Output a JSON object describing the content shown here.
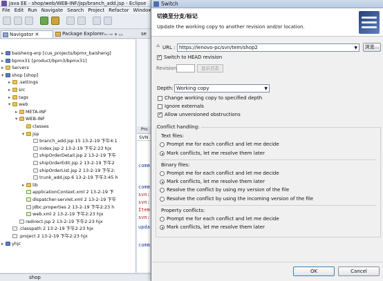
{
  "eclipse": {
    "window_title": "Java EE - shop/web/WEB-INF/jsp/branch_add.jsp - Eclipse",
    "menu": [
      "File",
      "Edit",
      "Run",
      "Navigate",
      "Search",
      "Project",
      "Refactor",
      "Window"
    ],
    "tabs": {
      "navigator": "Navigator",
      "package_explorer": "Package Explorer",
      "editor_tab": "se",
      "console_tab": "Pro",
      "svn_tab": "SVN"
    },
    "status_bar_text": "shop",
    "tree": [
      {
        "label": "baisheng-erp [cus_projects/bpmx_baisheng]",
        "type": "proj",
        "level": 1,
        "twisty": "+"
      },
      {
        "label": "bpmx31 [product/bpm3/bpmx31]",
        "type": "proj",
        "level": 1,
        "twisty": "+"
      },
      {
        "label": "Servers",
        "type": "fold",
        "level": 1,
        "twisty": "+"
      },
      {
        "label": "shop [shop]",
        "type": "proj",
        "level": 1,
        "twisty": "−"
      },
      {
        "label": ".settings",
        "type": "fold",
        "level": 2,
        "twisty": "+"
      },
      {
        "label": "src",
        "type": "fold",
        "level": 2,
        "twisty": "+"
      },
      {
        "label": "tags",
        "type": "fold",
        "level": 2,
        "twisty": "+"
      },
      {
        "label": "web",
        "type": "fold",
        "level": 2,
        "twisty": "−"
      },
      {
        "label": "META-INF",
        "type": "fold",
        "level": 3,
        "twisty": "+"
      },
      {
        "label": "WEB-INF",
        "type": "fold",
        "level": 3,
        "twisty": "−"
      },
      {
        "label": "classes",
        "type": "fold",
        "level": 4,
        "twisty": ""
      },
      {
        "label": "jsp",
        "type": "fold",
        "level": 4,
        "twisty": "−"
      },
      {
        "label": "branch_add.jsp 15  13-2-19 下午4:1",
        "type": "file",
        "level": 5,
        "twisty": ""
      },
      {
        "label": "index.jsp 2  13-2-19 下午2:23  hjx",
        "type": "file",
        "level": 5,
        "twisty": ""
      },
      {
        "label": "shipOrderDetail.jsp 2  13-2-19 下午",
        "type": "file",
        "level": 5,
        "twisty": ""
      },
      {
        "label": "shipOrderEdit.jsp 2  13-2-19 下午2",
        "type": "file",
        "level": 5,
        "twisty": ""
      },
      {
        "label": "shipOrderList.jsp 2  13-2-19 下午2:",
        "type": "file",
        "level": 5,
        "twisty": ""
      },
      {
        "label": "trunk_add.jsp 6  13-2-19 下午3:45  h",
        "type": "file",
        "level": 5,
        "twisty": ""
      },
      {
        "label": "lib",
        "type": "fold",
        "level": 4,
        "twisty": "+"
      },
      {
        "label": "applicationContext.xml 2  13-2-19 下",
        "type": "xml",
        "level": 4,
        "twisty": ""
      },
      {
        "label": "dispatcher-servlet.xml 2  13-2-19 下午",
        "type": "xml",
        "level": 4,
        "twisty": ""
      },
      {
        "label": "jdbc.properties 2  13-2-19 下午2:23  h",
        "type": "file",
        "level": 4,
        "twisty": ""
      },
      {
        "label": "web.xml 2  13-2-19 下午2:23  hjx",
        "type": "xml",
        "level": 4,
        "twisty": ""
      },
      {
        "label": "redirect.jsp 2  13-2-19 下午2:23  hjx",
        "type": "file",
        "level": 3,
        "twisty": ""
      },
      {
        "label": ".classpath 2  13-2-19 下午2:23  hjx",
        "type": "file",
        "level": 2,
        "twisty": ""
      },
      {
        "label": ".project 2  13-2-19 下午2:23  hjx",
        "type": "file",
        "level": 2,
        "twisty": ""
      },
      {
        "label": "yhjc",
        "type": "proj",
        "level": 1,
        "twisty": "+"
      }
    ],
    "console_lines": [
      {
        "text": "comm",
        "style": "blue"
      },
      {
        "text": "comm",
        "style": "blue"
      },
      {
        "text": "svn:",
        "style": "red"
      },
      {
        "text": "svn:",
        "style": "red"
      },
      {
        "text": "Item",
        "style": "red"
      },
      {
        "text": "svn:",
        "style": "red"
      },
      {
        "text": "upda",
        "style": "blue"
      },
      {
        "text": "comm",
        "style": "blue"
      }
    ]
  },
  "dialog": {
    "title": "Switch",
    "heading": "切换至分支/标记",
    "description": "Update the working copy to another revision and/or location.",
    "url_label": "URL :",
    "url_value": "https://lenovo-pc/svn/tem/shop2",
    "browse_label": "浏览...",
    "switch_head_label": "Switch to HEAD revision",
    "switch_head_checked": true,
    "revision_label": "Revision:",
    "revision_value": "",
    "show_log_label": "显示日志",
    "depth_label": "Depth:",
    "depth_value": "Working copy",
    "change_depth_label": "Change working copy to specified depth",
    "change_depth_checked": false,
    "ignore_externals_label": "Ignore externals",
    "ignore_externals_checked": false,
    "allow_unversioned_label": "Allow unversioned obstructions",
    "allow_unversioned_checked": true,
    "conflict_group_label": "Conflict handling:",
    "text_files": {
      "label": "Text files:",
      "options": [
        "Prompt me for each conflict and let me decide",
        "Mark conflicts, let me resolve them later"
      ],
      "selected": 1
    },
    "binary_files": {
      "label": "Binary files:",
      "options": [
        "Prompt me for each conflict and let me decide",
        "Mark conflicts, let me resolve them later",
        "Resolve the conflict by using my version of the file",
        "Resolve the conflict by using the incoming version of the file"
      ],
      "selected": 1
    },
    "property_conflicts": {
      "label": "Property conflicts:",
      "options": [
        "Prompt me for each conflict and let me decide",
        "Mark conflicts, let me resolve them later"
      ],
      "selected": 1
    },
    "ok_label": "OK",
    "cancel_label": "Cancel"
  }
}
